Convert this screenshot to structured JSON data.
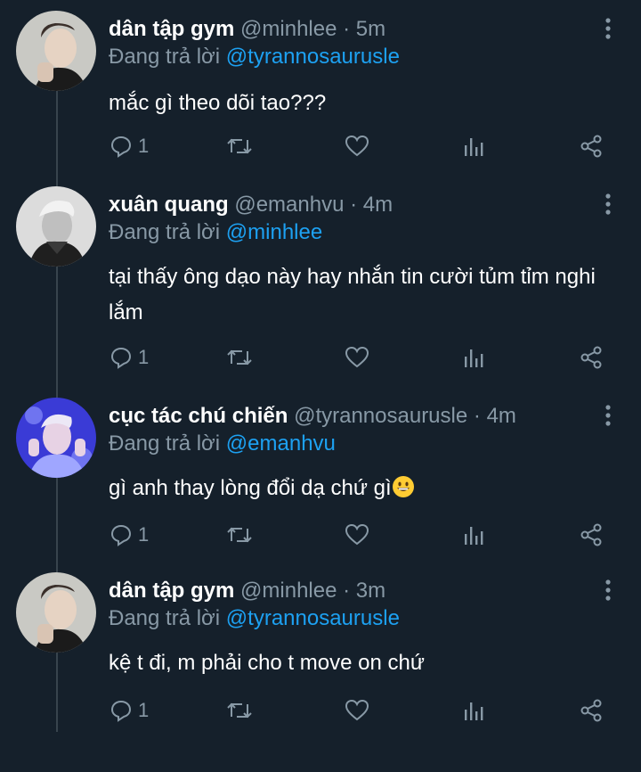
{
  "tweets": [
    {
      "name": "dân tập gym",
      "handle": "@minhlee",
      "time": "5m",
      "reply_prefix": "Đang trả lời",
      "reply_to": "@tyrannosaurusle",
      "text": "mắc gì theo dõi tao???",
      "reply_count": "1",
      "avatar": "avatar-minhlee"
    },
    {
      "name": "xuân quang",
      "handle": "@emanhvu",
      "time": "4m",
      "reply_prefix": "Đang trả lời",
      "reply_to": "@minhlee",
      "text": "tại thấy ông dạo này hay nhắn tin cười tủm tỉm nghi lắm",
      "reply_count": "1",
      "avatar": "avatar-emanhvu"
    },
    {
      "name": "cục tác chú chiến",
      "handle": "@tyrannosaurusle",
      "time": "4m",
      "reply_prefix": "Đang trả lời",
      "reply_to": "@emanhvu",
      "text": "gì anh thay lòng đổi dạ chứ gì",
      "emoji": "grinning-face-emoji",
      "reply_count": "1",
      "avatar": "avatar-tyrannosaurusle"
    },
    {
      "name": "dân tập gym",
      "handle": "@minhlee",
      "time": "3m",
      "reply_prefix": "Đang trả lời",
      "reply_to": "@tyrannosaurusle",
      "text": "kệ t đi, m phải cho t move on chứ",
      "reply_count": "1",
      "avatar": "avatar-minhlee"
    }
  ],
  "separator": "·",
  "icons": [
    "reply-icon",
    "retweet-icon",
    "like-icon",
    "analytics-icon",
    "share-icon",
    "more-options-icon"
  ],
  "colors": {
    "background": "#15202b",
    "secondary_text": "#8899a6",
    "mention": "#1da1f2",
    "thread_line": "#38444d"
  }
}
